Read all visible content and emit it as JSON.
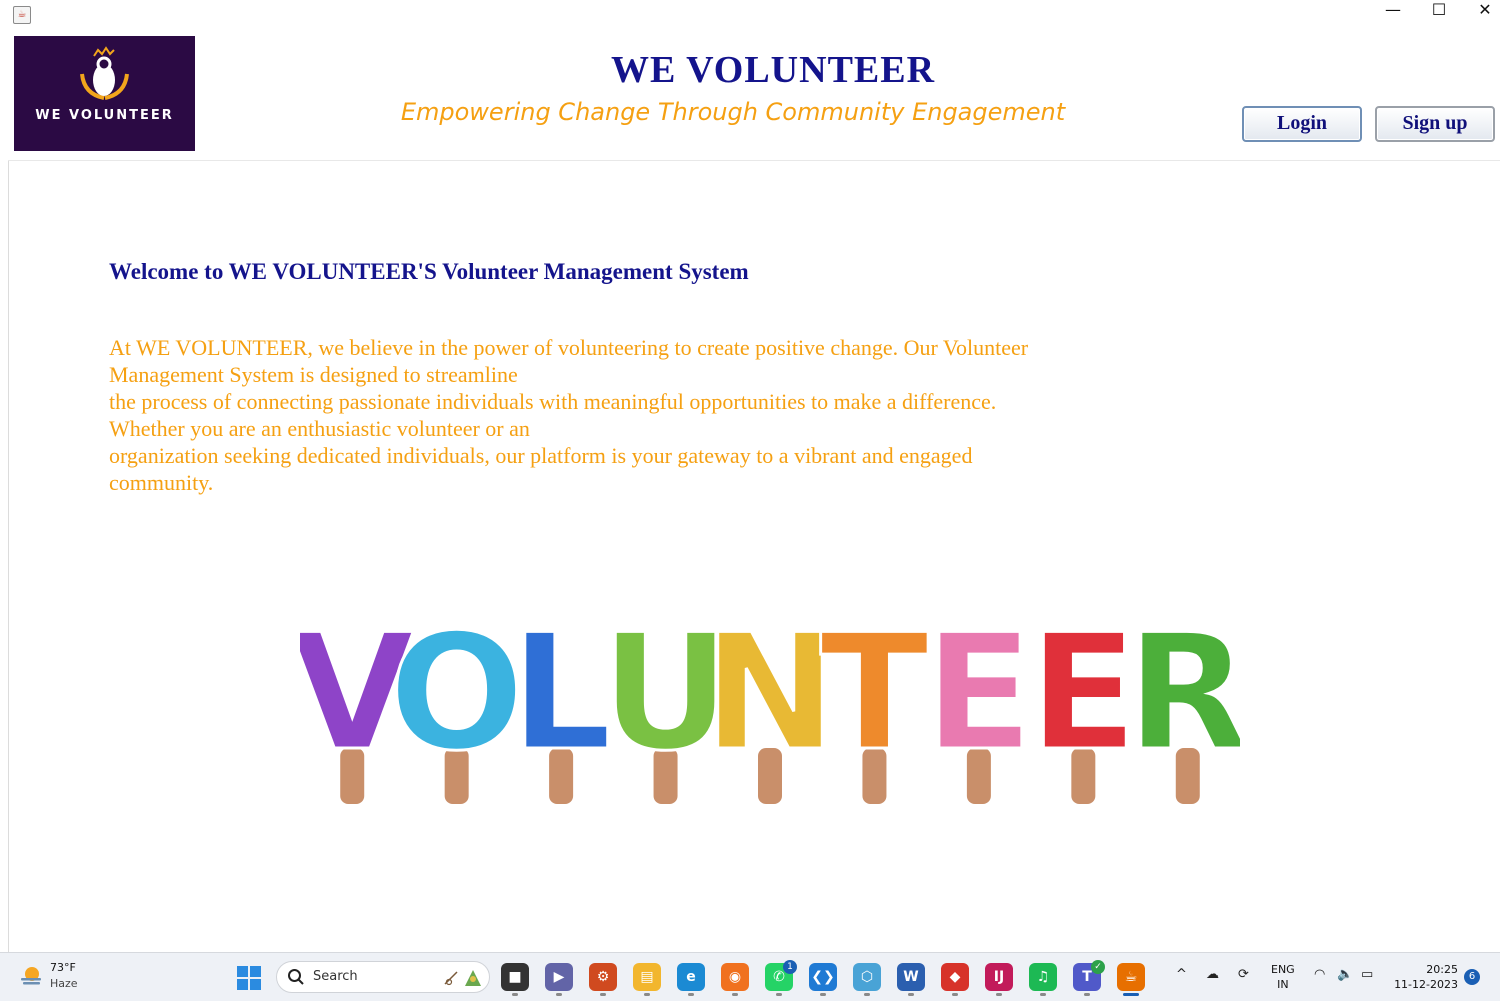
{
  "window": {
    "controls": {
      "minimize": "—",
      "maximize": "☐",
      "close": "✕"
    }
  },
  "header": {
    "logo_text": "WE VOLUNTEER",
    "title": "WE VOLUNTEER",
    "tagline": "Empowering Change Through Community Engagement",
    "login_label": "Login",
    "signup_label": "Sign up"
  },
  "main": {
    "welcome": "Welcome to WE VOLUNTEER'S Volunteer Management System",
    "intro_lines": [
      "At WE VOLUNTEER, we believe in the power of volunteering to create positive change. Our Volunteer",
      "Management System is designed to streamline",
      "the process of connecting passionate individuals with meaningful opportunities to make a difference.",
      "Whether you are an enthusiastic volunteer or an",
      "organization seeking dedicated individuals, our platform is your gateway to a vibrant and engaged",
      "community."
    ],
    "banner_letters": [
      "V",
      "O",
      "L",
      "U",
      "N",
      "T",
      "E",
      "E",
      "R"
    ],
    "banner_colors": [
      "#8e44c8",
      "#3bb3e0",
      "#2f6fd6",
      "#7ac143",
      "#e8b934",
      "#ee8a2c",
      "#e97ab0",
      "#e0303a",
      "#4caf3a"
    ]
  },
  "taskbar": {
    "weather": {
      "temp": "73°F",
      "condition": "Haze"
    },
    "search_placeholder": "Search",
    "apps": [
      {
        "name": "file-explorer-dark",
        "glyph": "■",
        "color": "#333333"
      },
      {
        "name": "video-chat",
        "glyph": "▶",
        "color": "#6264a7"
      },
      {
        "name": "settings-gear",
        "glyph": "⚙",
        "color": "#d04a1f"
      },
      {
        "name": "file-explorer",
        "glyph": "▤",
        "color": "#f2b62e"
      },
      {
        "name": "edge-browser",
        "glyph": "e",
        "color": "#1b8ad3"
      },
      {
        "name": "firefox-browser",
        "glyph": "◉",
        "color": "#f0711f"
      },
      {
        "name": "whatsapp",
        "glyph": "✆",
        "color": "#25d366"
      },
      {
        "name": "vscode",
        "glyph": "❮❯",
        "color": "#1f7ad4"
      },
      {
        "name": "hexagon-app",
        "glyph": "⬡",
        "color": "#49a3d6"
      },
      {
        "name": "word",
        "glyph": "W",
        "color": "#2b5faf"
      },
      {
        "name": "git-app",
        "glyph": "◆",
        "color": "#d7332a"
      },
      {
        "name": "intellij",
        "glyph": "IJ",
        "color": "#c21b5a"
      },
      {
        "name": "spotify",
        "glyph": "♫",
        "color": "#1db954"
      },
      {
        "name": "teams",
        "glyph": "T",
        "color": "#5059c9"
      },
      {
        "name": "java-app",
        "glyph": "☕",
        "color": "#e76f00"
      }
    ],
    "whatsapp_badge": "1",
    "language_top": "ENG",
    "language_bottom": "IN",
    "time": "20:25",
    "date": "11-12-2023",
    "notifications": "6"
  }
}
